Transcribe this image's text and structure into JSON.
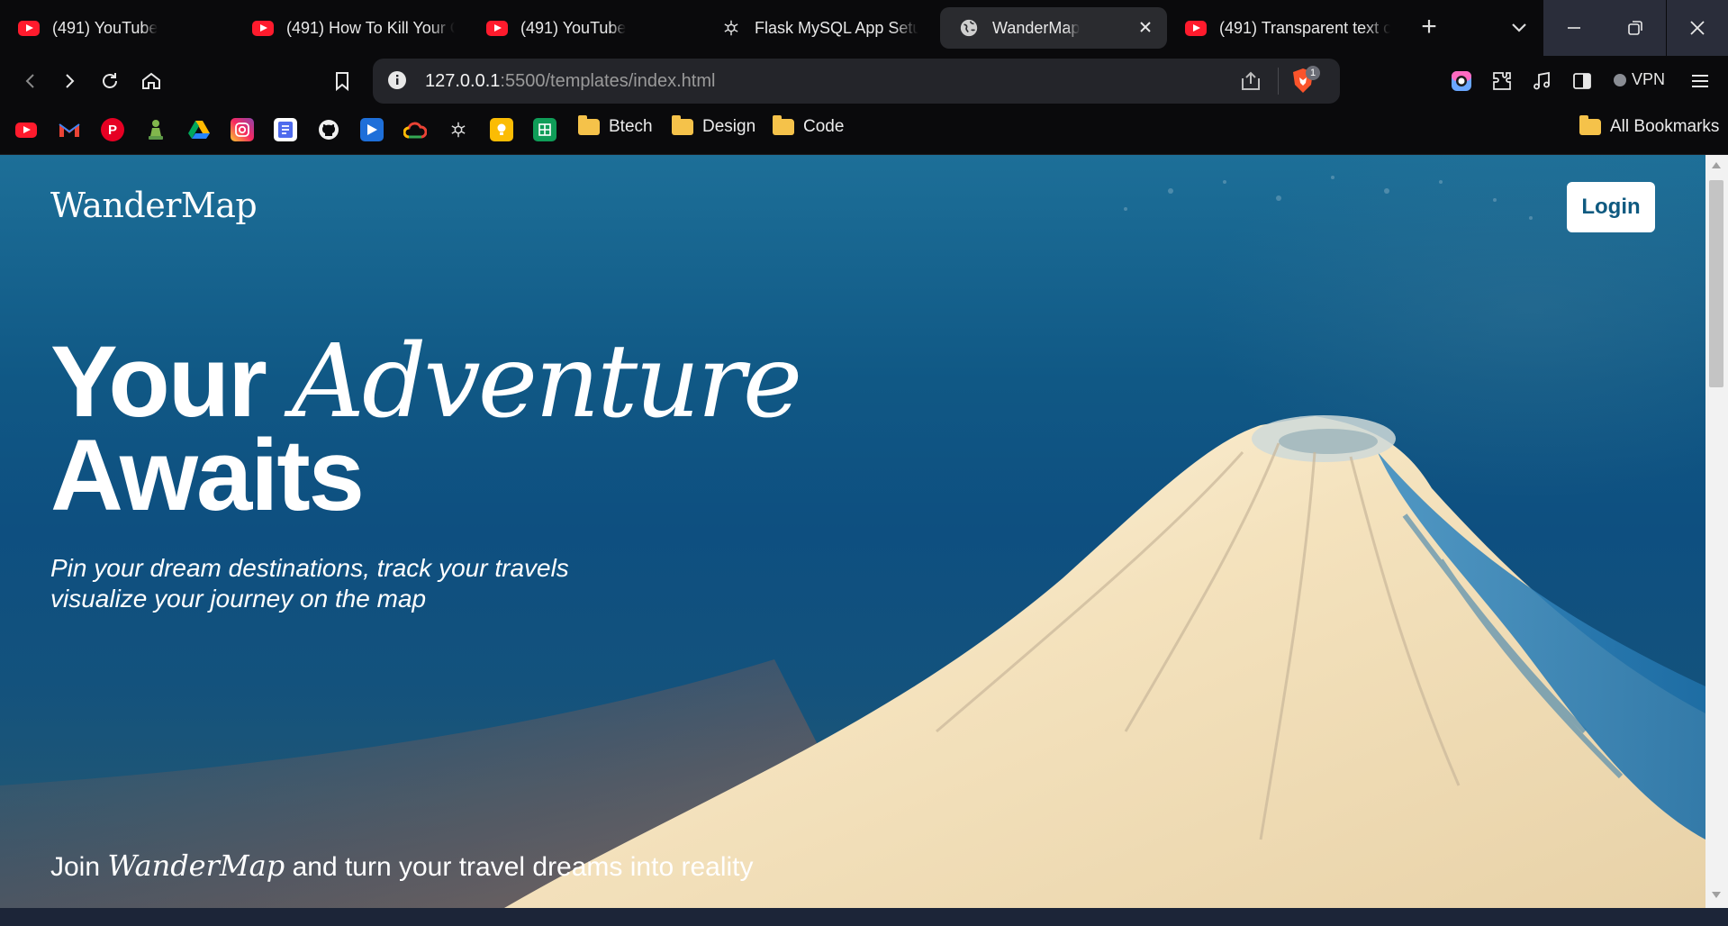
{
  "browser": {
    "tabs": [
      {
        "title": "(491) YouTube",
        "icon": "youtube-icon"
      },
      {
        "title": "(491) How To Kill Your C",
        "icon": "youtube-icon"
      },
      {
        "title": "(491) YouTube",
        "icon": "youtube-icon"
      },
      {
        "title": "Flask MySQL App Setup",
        "icon": "chatgpt-icon"
      },
      {
        "title": "WanderMap",
        "icon": "globe-icon",
        "active": true
      },
      {
        "title": "(491) Transparent text c",
        "icon": "youtube-icon"
      }
    ],
    "url": {
      "host": "127.0.0.1",
      "rest": ":5500/templates/index.html"
    },
    "brave_badge": "1",
    "vpn_label": "VPN",
    "bookmark_folders": [
      "Btech",
      "Design",
      "Code"
    ],
    "all_bookmarks": "All Bookmarks",
    "bookmark_icons": [
      "youtube-icon",
      "gmail-icon",
      "pinterest-icon",
      "chess-icon",
      "drive-icon",
      "instagram-icon",
      "docs-icon",
      "github-icon",
      "video-icon",
      "cloud-icon",
      "chatgpt-icon",
      "keep-icon",
      "sheets-icon"
    ]
  },
  "page": {
    "logo": "WanderMap",
    "login_label": "Login",
    "hero": {
      "word1": "Your",
      "word2": "Adventure",
      "line2": "Awaits"
    },
    "tagline": {
      "line1": "Pin your dream destinations, track your travels",
      "line2": "visualize your journey on the map"
    },
    "join": {
      "before": "Join",
      "brand": "WanderMap",
      "after": "and turn your travel dreams into reality"
    }
  }
}
